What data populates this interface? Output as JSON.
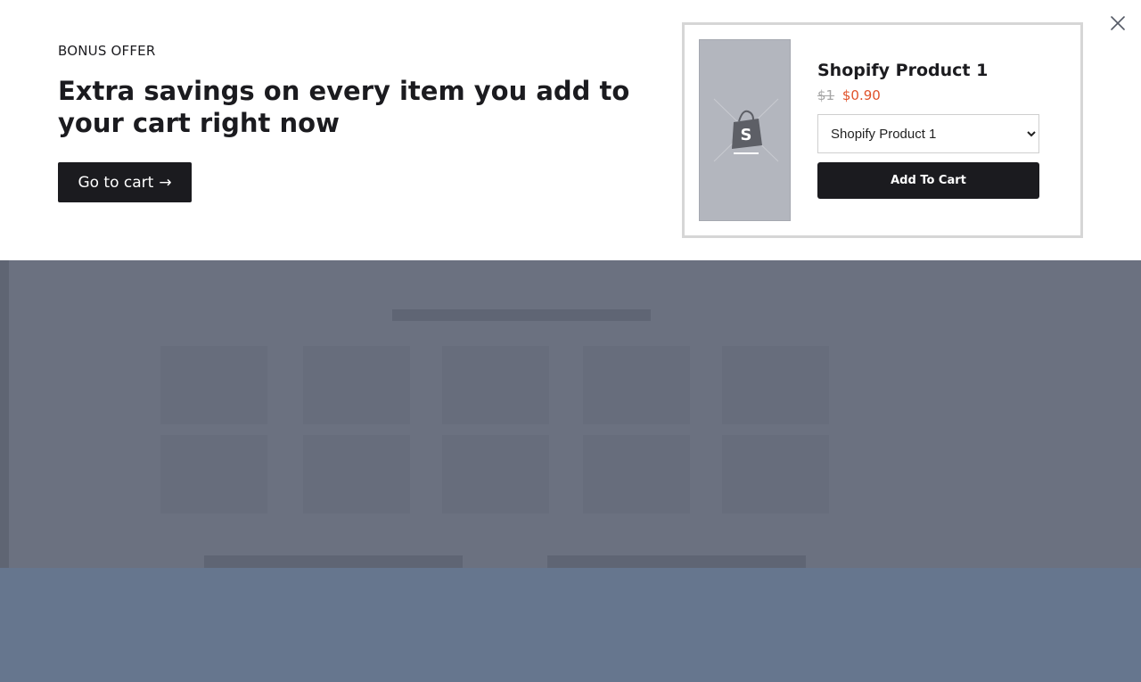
{
  "banner": {
    "eyebrow": "BONUS OFFER",
    "headline": "Extra savings on every item you add to your cart right now",
    "cart_button_label": "Go to cart",
    "cart_button_arrow": "→",
    "close_icon": "close-icon"
  },
  "product": {
    "title": "Shopify Product 1",
    "price_original": "$1",
    "price_sale": "$0.90",
    "variant_selected": "Shopify Product 1",
    "add_to_cart_label": "Add To Cart",
    "image_icon": "shopify-bag-icon"
  },
  "colors": {
    "accent_dark": "#1b1b1f",
    "sale_price": "#e0532b",
    "overlay": "#6b7180",
    "footer": "#66768e"
  }
}
